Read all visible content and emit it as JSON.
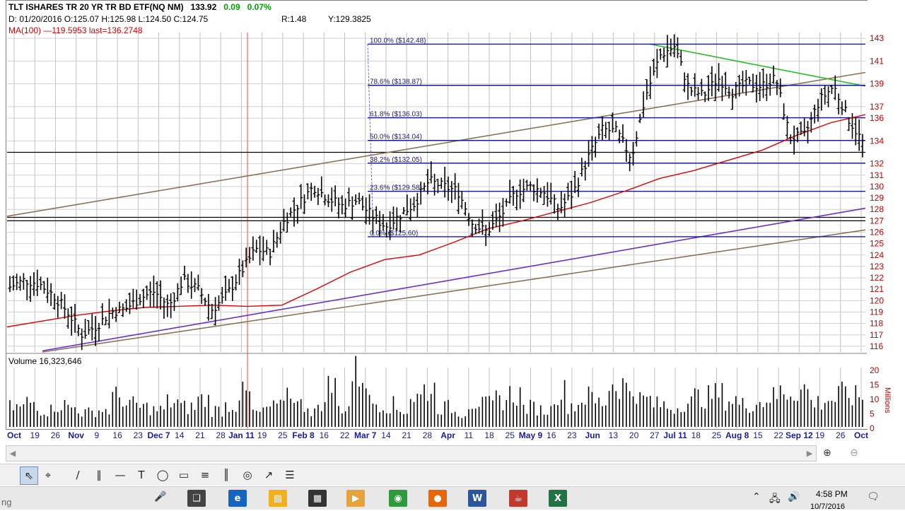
{
  "header": {
    "symbol": "TLT ISHARES TR 20 YR TR BD ETF(NQ NM)",
    "last": "133.92",
    "change": "0.09",
    "change_pct": "0.07%",
    "ohlc": "D: 01/20/2016 O:125.07 H:125.98 L:124.50 C:124.75",
    "r_value": "R:1.48",
    "y_value": "Y:129.3825",
    "ma_text": "MA(100) —119.5953 last=136.2748"
  },
  "colors": {
    "bars": "#000000",
    "ma": "#e00000",
    "fib": "#1a1a8c",
    "trend_brown": "#8b7355",
    "trend_purple": "#6a2fd0",
    "trend_green": "#22c022",
    "axis_right": "#c00000",
    "cursor": "#ff4040"
  },
  "volume": {
    "label": "Volume 16,323,646"
  },
  "chart_data": [
    {
      "type": "bar",
      "name": "price",
      "description_of_series": "OHLC daily bars",
      "ylim": [
        115.5,
        143.5
      ],
      "y_ticks": [
        143,
        141,
        139,
        137,
        136,
        134,
        132,
        131,
        130,
        129,
        128,
        127,
        126,
        125,
        124,
        123,
        122,
        121,
        120,
        119,
        118,
        117,
        116
      ],
      "x_tick_labels": [
        "Oct",
        "19",
        "26",
        "Nov",
        "9",
        "16",
        "23",
        "Dec 7",
        "14",
        "21",
        "28",
        "Jan 11",
        "19",
        "25",
        "Feb 8",
        "16",
        "22",
        "Mar 7",
        "14",
        "21",
        "28",
        "Apr",
        "11",
        "18",
        "25",
        "May 9",
        "16",
        "23",
        "Jun",
        "13",
        "20",
        "27",
        "Jul 11",
        "18",
        "25",
        "Aug 8",
        "15",
        "22",
        "Sep 12",
        "19",
        "26",
        "Oct"
      ],
      "closes_approx": [
        121.2,
        121.8,
        121.5,
        120.5,
        119.0,
        117.0,
        117.8,
        119.0,
        119.3,
        120.2,
        120.8,
        119.5,
        121.8,
        121.0,
        119.2,
        120.5,
        122.5,
        124.5,
        124.2,
        127.0,
        128.5,
        130.0,
        129.0,
        128.3,
        128.8,
        127.5,
        126.5,
        127.5,
        128.5,
        130.5,
        130.0,
        129.6,
        126.8,
        126.0,
        127.5,
        129.5,
        130.0,
        129.5,
        128.0,
        129.5,
        132.5,
        135.0,
        134.8,
        132.5,
        138.0,
        141.5,
        142.3,
        138.5,
        138.0,
        139.5,
        138.3,
        139.0,
        138.8,
        139.5,
        134.2,
        134.5,
        137.5,
        138.8,
        136.0,
        133.9
      ],
      "moving_average": {
        "label": "MA(100)",
        "value": 119.5953,
        "last": 136.2748,
        "values_approx": [
          117.7,
          118.2,
          118.7,
          119.1,
          119.4,
          119.5,
          119.6,
          119.5,
          119.6,
          121.0,
          122.5,
          123.6,
          124.0,
          125.1,
          126.3,
          127.0,
          127.8,
          128.6,
          129.6,
          130.7,
          131.4,
          132.3,
          133.2,
          134.5,
          135.6,
          136.3
        ]
      },
      "fibonacci": [
        {
          "label": "100.0% ($142.48)",
          "value": 142.48
        },
        {
          "label": "78.6% ($138.87)",
          "value": 138.87
        },
        {
          "label": "61.8% ($136.03)",
          "value": 136.03
        },
        {
          "label": "50.0% ($134.04)",
          "value": 134.04
        },
        {
          "label": "38.2% ($132.05)",
          "value": 132.05
        },
        {
          "label": "23.6% ($129.58)",
          "value": 129.58
        },
        {
          "label": "0.0% ($125.60)",
          "value": 125.6
        }
      ],
      "horizontal_lines": [
        133.0,
        127.0,
        127.3
      ],
      "trendlines": [
        {
          "color": "brown",
          "from": 127.4,
          "to": 140.0
        },
        {
          "color": "purple",
          "from": 115.6,
          "to": 128.1
        },
        {
          "color": "brown",
          "from": 115.5,
          "to": 126.2
        },
        {
          "color": "green",
          "from": 142.5,
          "to": 138.8
        }
      ]
    },
    {
      "type": "bar",
      "name": "volume",
      "ylabel": "Millions",
      "ylim": [
        0,
        21
      ],
      "y_ticks": [
        20,
        15,
        10,
        5,
        0
      ],
      "values_approx": [
        8,
        10,
        7,
        9,
        8,
        6,
        7,
        12,
        9,
        8,
        7,
        10,
        8,
        11,
        7,
        9,
        13,
        6,
        8,
        14,
        9,
        7,
        16,
        8,
        21,
        10,
        9,
        7,
        12,
        15,
        8,
        6,
        10,
        9,
        11,
        13,
        8,
        7,
        14,
        9,
        12,
        10,
        17,
        15,
        11,
        9,
        8,
        10,
        12,
        13,
        11,
        9,
        10,
        12,
        14,
        15,
        10,
        11,
        13,
        12
      ]
    }
  ],
  "toolbar": {
    "tools": [
      "pointer",
      "crosshair",
      "pencil",
      "parallel-lines",
      "horizontal-line",
      "text",
      "ellipse",
      "rectangle",
      "fibonacci",
      "gann",
      "cycles",
      "speed-lines",
      "menu"
    ],
    "glyphs": [
      "⇖",
      "⌖",
      "∕",
      "∥",
      "—",
      "T",
      "◯",
      "▭",
      "≡",
      "║",
      "◎",
      "↗",
      "☰"
    ]
  },
  "scroll": {
    "left_arrow": "◀",
    "right_arrow": "▶",
    "zoom_in": "⊕",
    "zoom_out": "⊖"
  },
  "taskbar": {
    "search_text": "ng",
    "time": "4:58 PM",
    "date": "10/7/2016",
    "icons": [
      {
        "name": "task-view",
        "glyph": "❑",
        "color": "#444444"
      },
      {
        "name": "edge",
        "glyph": "e",
        "color": "#1565c0"
      },
      {
        "name": "file-explorer",
        "glyph": "▤",
        "color": "#f2b01e"
      },
      {
        "name": "store",
        "glyph": "▦",
        "color": "#333333"
      },
      {
        "name": "media-player",
        "glyph": "▶",
        "color": "#e6a23c"
      },
      {
        "name": "chrome",
        "glyph": "◉",
        "color": "#2e9a3c"
      },
      {
        "name": "firefox",
        "glyph": "●",
        "color": "#e8660b"
      },
      {
        "name": "word",
        "glyph": "W",
        "color": "#2b579a"
      },
      {
        "name": "java",
        "glyph": "☕",
        "color": "#c0392b"
      },
      {
        "name": "excel",
        "glyph": "X",
        "color": "#217346"
      }
    ]
  }
}
